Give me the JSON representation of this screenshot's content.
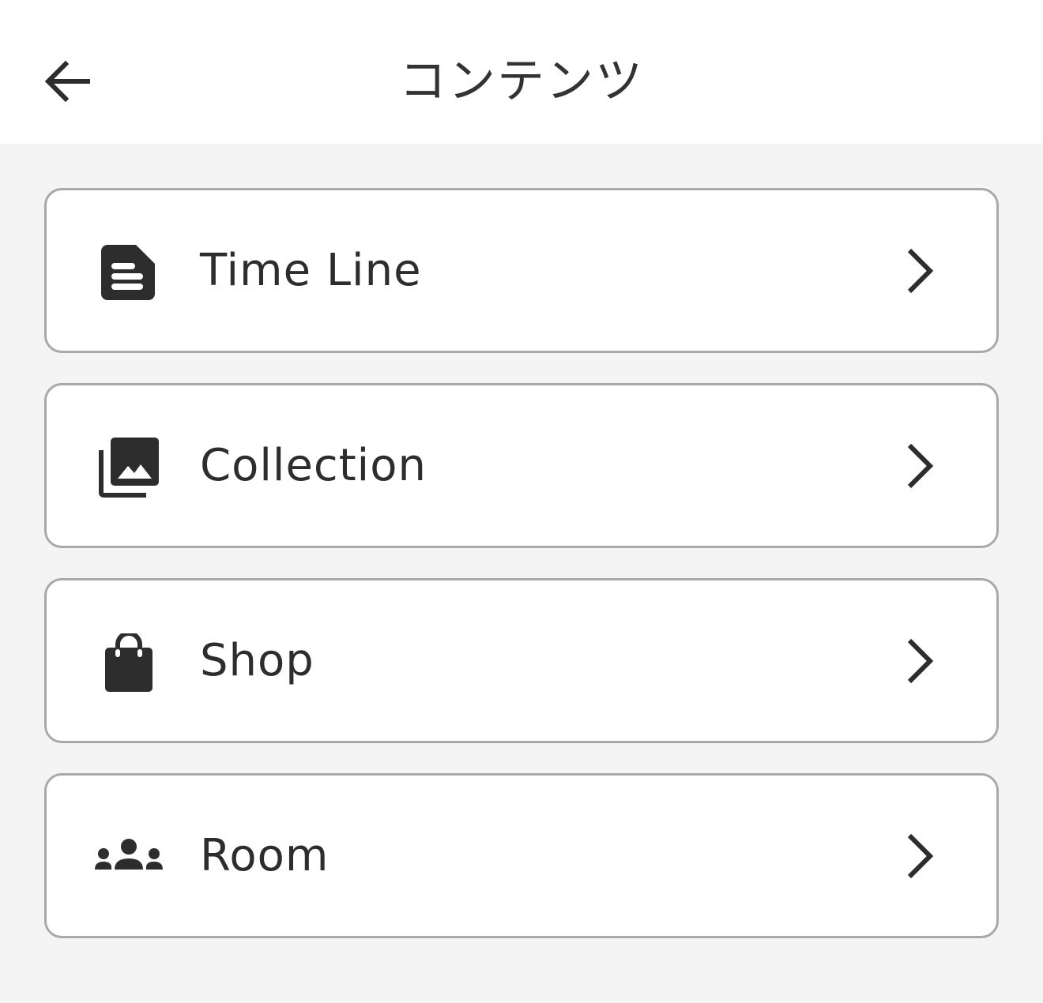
{
  "header": {
    "title": "コンテンツ",
    "back_icon": "arrow-left-icon"
  },
  "menu": {
    "items": [
      {
        "label": "Time Line",
        "icon": "document-icon"
      },
      {
        "label": "Collection",
        "icon": "photo-library-icon"
      },
      {
        "label": "Shop",
        "icon": "shopping-bag-icon"
      },
      {
        "label": "Room",
        "icon": "group-icon"
      }
    ],
    "chevron_icon": "chevron-right-icon"
  },
  "colors": {
    "background": "#f4f4f4",
    "surface": "#ffffff",
    "text": "#2d2d2d",
    "border": "#a9a9a9"
  }
}
